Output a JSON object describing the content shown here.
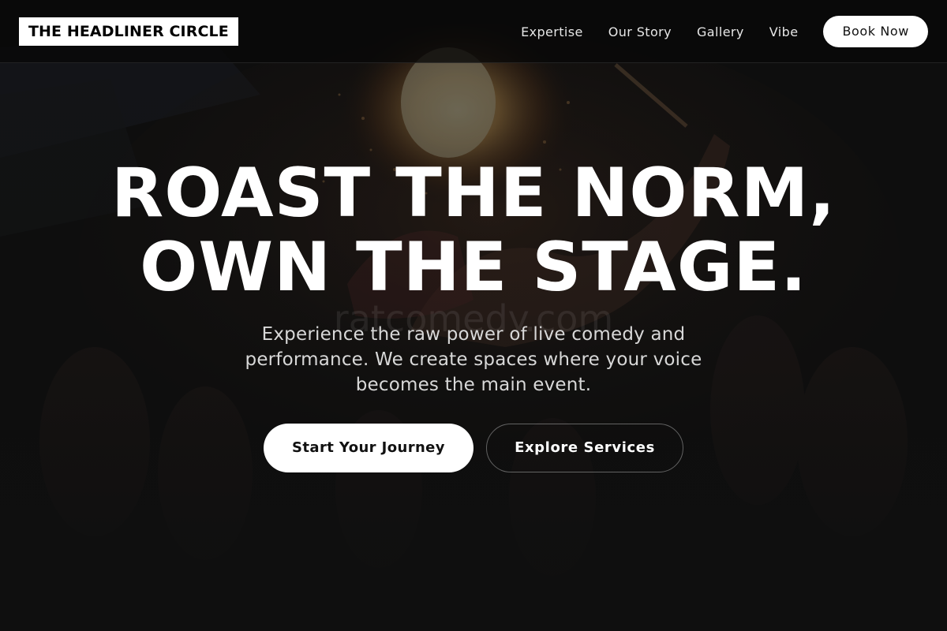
{
  "header": {
    "logo": "THE HEADLINER CIRCLE",
    "nav": [
      {
        "label": "Expertise"
      },
      {
        "label": "Our Story"
      },
      {
        "label": "Gallery"
      },
      {
        "label": "Vibe"
      }
    ],
    "cta_label": "Book Now"
  },
  "hero": {
    "title_line1": "ROAST THE NORM,",
    "title_line2": "OWN THE STAGE.",
    "subtitle": "Experience the raw power of live comedy and performance. We create spaces where your voice becomes the main event.",
    "primary_cta": "Start Your Journey",
    "secondary_cta": "Explore Services",
    "background_image": "fire-performer-photo",
    "watermark": "ratcomedy.com"
  },
  "colors": {
    "background": "#0f0f0f",
    "text": "#ffffff",
    "button_bg": "#ffffff",
    "button_text": "#111111"
  }
}
